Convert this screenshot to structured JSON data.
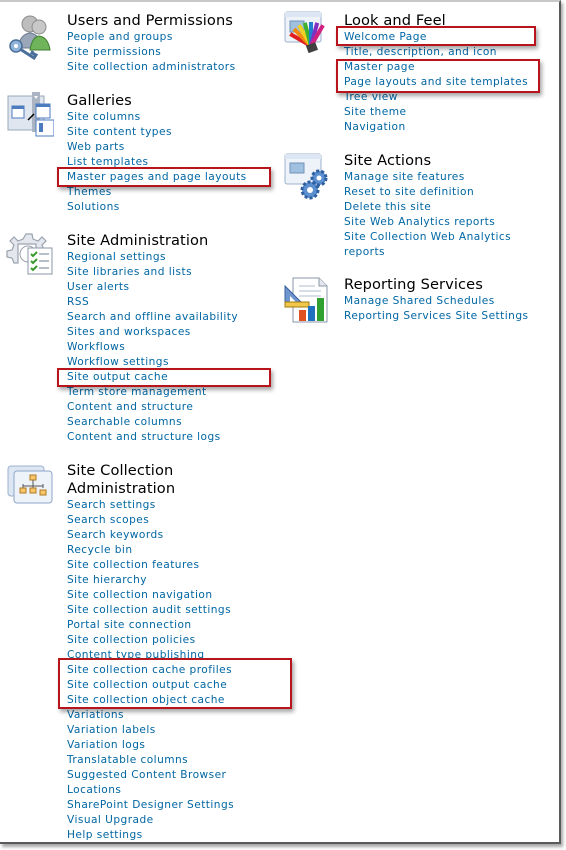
{
  "page": {
    "highlight_color": "#b8141c",
    "link_color": "#0066a3",
    "heading_color": "#000000"
  },
  "left_column": [
    {
      "heading": "Users and Permissions",
      "icon": "users-key-icon",
      "links": [
        "People and groups",
        "Site permissions",
        "Site collection administrators"
      ]
    },
    {
      "heading": "Galleries",
      "icon": "galleries-icon",
      "links": [
        "Site columns",
        "Site content types",
        "Web parts",
        "List templates",
        "Master pages and page layouts",
        "Themes",
        "Solutions"
      ]
    },
    {
      "heading": "Site Administration",
      "icon": "gear-checklist-icon",
      "links": [
        "Regional settings",
        "Site libraries and lists",
        "User alerts",
        "RSS",
        "Search and offline availability",
        "Sites and workspaces",
        "Workflows",
        "Workflow settings",
        "Site output cache",
        "Term store management",
        "Content and structure",
        "Searchable columns",
        "Content and structure logs"
      ]
    },
    {
      "heading_line1": "Site Collection",
      "heading_line2": "Administration",
      "icon": "hierarchy-icon",
      "links": [
        "Search settings",
        "Search scopes",
        "Search keywords",
        "Recycle bin",
        "Site collection features",
        "Site hierarchy",
        "Site collection navigation",
        "Site collection audit settings",
        "Portal site connection",
        "Site collection policies",
        "Content type publishing",
        "Site collection cache profiles",
        "Site collection output cache",
        "Site collection object cache",
        "Variations",
        "Variation labels",
        "Variation logs",
        "Translatable columns",
        "Suggested Content Browser",
        "Locations",
        "SharePoint Designer Settings",
        "Visual Upgrade",
        "Help settings"
      ]
    }
  ],
  "right_column": [
    {
      "heading": "Look and Feel",
      "icon": "color-palette-icon",
      "links": [
        "Welcome Page",
        "Title, description, and icon",
        "Master page",
        "Page layouts and site templates",
        "Tree view",
        "Site theme",
        "Navigation"
      ]
    },
    {
      "heading": "Site Actions",
      "icon": "window-gears-icon",
      "links": [
        "Manage site features",
        "Reset to site definition",
        "Delete this site",
        "Site Web Analytics reports",
        "Site Collection Web Analytics",
        "reports"
      ]
    },
    {
      "heading": "Reporting Services",
      "icon": "report-chart-icon",
      "links": [
        "Manage Shared Schedules",
        "Reporting Services Site Settings"
      ]
    }
  ],
  "highlighted_items": [
    "Master pages and page layouts",
    "Site output cache",
    "Site collection cache profiles",
    "Site collection output cache",
    "Site collection object cache",
    "Welcome Page",
    "Master page",
    "Page layouts and site templates"
  ]
}
